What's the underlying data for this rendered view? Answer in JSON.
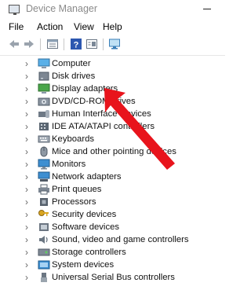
{
  "window": {
    "title": "Device Manager"
  },
  "menu": {
    "items": [
      "File",
      "Action",
      "View",
      "Help"
    ]
  },
  "toolbar": {
    "icons": [
      "back-arrow-icon",
      "forward-arrow-icon",
      "properties-icon",
      "help-icon",
      "update-driver-icon",
      "scan-hardware-icon"
    ]
  },
  "tree": {
    "items": [
      {
        "label": "Computer",
        "icon": "computer-icon"
      },
      {
        "label": "Disk drives",
        "icon": "disk-drive-icon"
      },
      {
        "label": "Display adapters",
        "icon": "display-adapter-icon"
      },
      {
        "label": "DVD/CD-ROM drives",
        "icon": "dvd-drive-icon"
      },
      {
        "label": "Human Interface Devices",
        "icon": "hid-icon"
      },
      {
        "label": "IDE ATA/ATAPI controllers",
        "icon": "ide-controller-icon"
      },
      {
        "label": "Keyboards",
        "icon": "keyboard-icon"
      },
      {
        "label": "Mice and other pointing devices",
        "icon": "mouse-icon"
      },
      {
        "label": "Monitors",
        "icon": "monitor-icon"
      },
      {
        "label": "Network adapters",
        "icon": "network-adapter-icon"
      },
      {
        "label": "Print queues",
        "icon": "printer-icon"
      },
      {
        "label": "Processors",
        "icon": "processor-icon"
      },
      {
        "label": "Security devices",
        "icon": "security-key-icon"
      },
      {
        "label": "Software devices",
        "icon": "software-device-icon"
      },
      {
        "label": "Sound, video and game controllers",
        "icon": "sound-icon"
      },
      {
        "label": "Storage controllers",
        "icon": "storage-controller-icon"
      },
      {
        "label": "System devices",
        "icon": "system-device-icon"
      },
      {
        "label": "Universal Serial Bus controllers",
        "icon": "usb-icon"
      }
    ]
  },
  "annotation": {
    "icon": "red-pointer-arrow-icon",
    "color": "#e8141c"
  }
}
